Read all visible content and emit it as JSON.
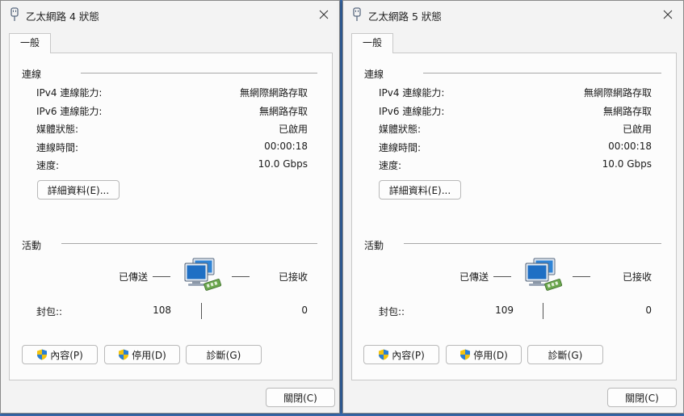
{
  "windows": [
    {
      "title": "乙太網路 4 狀態",
      "tab": "一般",
      "connection": {
        "heading": "連線",
        "rows": [
          {
            "label": "IPv4 連線能力:",
            "value": "無網際網路存取"
          },
          {
            "label": "IPv6 連線能力:",
            "value": "無網路存取"
          },
          {
            "label": "媒體狀態:",
            "value": "已啟用"
          },
          {
            "label": "連線時間:",
            "value": "00:00:18"
          },
          {
            "label": "速度:",
            "value": "10.0 Gbps"
          }
        ],
        "details_button": "詳細資料(E)..."
      },
      "activity": {
        "heading": "活動",
        "sent_label": "已傳送",
        "received_label": "已接收",
        "packets_label": "封包::",
        "sent_value": "108",
        "received_value": "0"
      },
      "buttons": {
        "properties": "內容(P)",
        "disable": "停用(D)",
        "diagnose": "診斷(G)",
        "close": "關閉(C)"
      }
    },
    {
      "title": "乙太網路 5 狀態",
      "tab": "一般",
      "connection": {
        "heading": "連線",
        "rows": [
          {
            "label": "IPv4 連線能力:",
            "value": "無網際網路存取"
          },
          {
            "label": "IPv6 連線能力:",
            "value": "無網路存取"
          },
          {
            "label": "媒體狀態:",
            "value": "已啟用"
          },
          {
            "label": "連線時間:",
            "value": "00:00:18"
          },
          {
            "label": "速度:",
            "value": "10.0 Gbps"
          }
        ],
        "details_button": "詳細資料(E)..."
      },
      "activity": {
        "heading": "活動",
        "sent_label": "已傳送",
        "received_label": "已接收",
        "packets_label": "封包::",
        "sent_value": "109",
        "received_value": "0"
      },
      "buttons": {
        "properties": "內容(P)",
        "disable": "停用(D)",
        "diagnose": "診斷(G)",
        "close": "關閉(C)"
      }
    }
  ],
  "icons": {
    "title": "network-adapter-icon",
    "close": "close-icon",
    "shield": "uac-shield-icon",
    "activity": "network-computers-icon"
  },
  "colors": {
    "desktop": "#3a6fb5",
    "window": "#f3f3f3",
    "panel": "#fcfcfc"
  }
}
